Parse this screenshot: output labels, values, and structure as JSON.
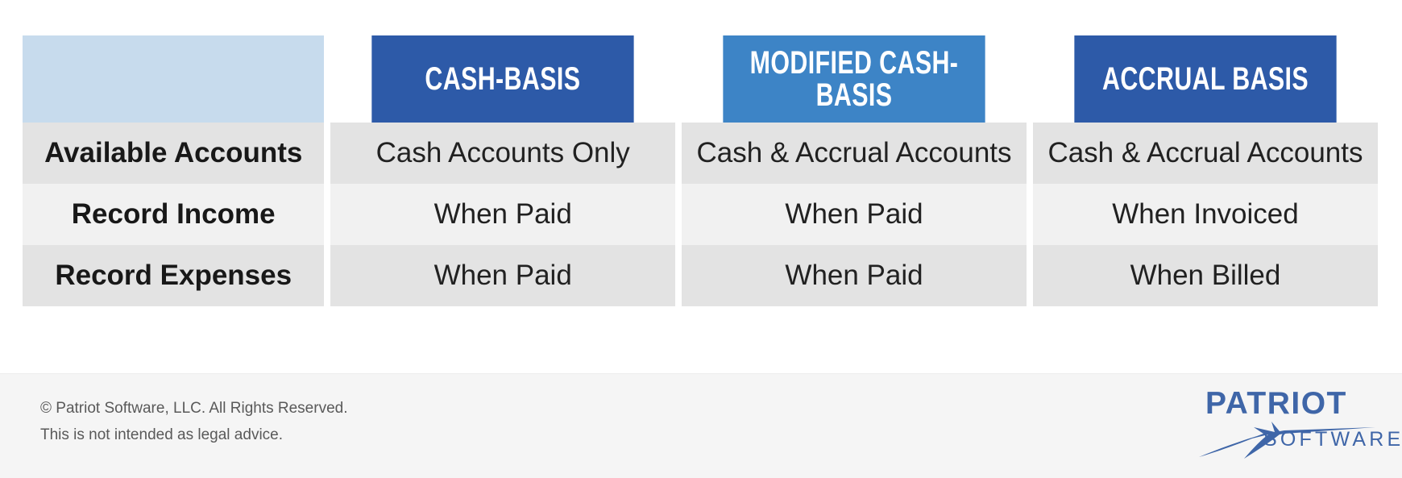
{
  "table": {
    "corner_label": "",
    "columns": [
      {
        "key": "cash",
        "label": "Cash-Basis",
        "color": "#2d5aa8"
      },
      {
        "key": "modified",
        "label": "Modified Cash-Basis",
        "color": "#3d84c6"
      },
      {
        "key": "accrual",
        "label": "Accrual Basis",
        "color": "#2d5aa8"
      }
    ],
    "rows": [
      {
        "label": "Available Accounts",
        "cash": "Cash Accounts Only",
        "modified": "Cash & Accrual Accounts",
        "accrual": "Cash & Accrual Accounts"
      },
      {
        "label": "Record Income",
        "cash": "When Paid",
        "modified": "When Paid",
        "accrual": "When Invoiced"
      },
      {
        "label": "Record Expenses",
        "cash": "When Paid",
        "modified": "When Paid",
        "accrual": "When Billed"
      }
    ]
  },
  "footer": {
    "copyright": "© Patriot Software, LLC. All Rights Reserved.",
    "disclaimer": "This is not intended as legal advice.",
    "logo": {
      "wordmark": "PATRIOT",
      "subword": "SOFTWARE",
      "color": "#3f66a8"
    }
  },
  "colors": {
    "header_dark_blue": "#2d5aa8",
    "header_light_blue": "#3d84c6",
    "corner_pale_blue": "#c7dbed",
    "row_shade": "#e3e3e3",
    "row_light": "#f1f1f1",
    "footer_band": "#f5f5f5",
    "brand_blue": "#3f66a8"
  }
}
